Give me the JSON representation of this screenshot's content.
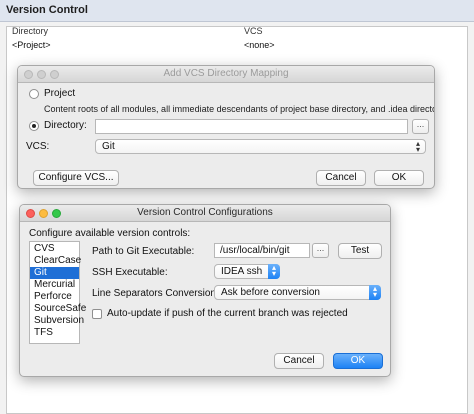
{
  "background": {
    "header_title": "Version Control",
    "columns": [
      "Directory",
      "VCS"
    ],
    "row": {
      "directory": "<Project>",
      "vcs": "<none>"
    }
  },
  "mapping_dialog": {
    "title": "Add VCS Directory Mapping",
    "project_label": "Project",
    "project_description": "Content roots of all modules, all immediate descendants of project base directory, and .idea directory contents",
    "directory_label": "Directory:",
    "directory_value": "",
    "browse_label": "...",
    "vcs_label": "VCS:",
    "vcs_value": "Git",
    "configure_label": "Configure VCS...",
    "cancel_label": "Cancel",
    "ok_label": "OK",
    "selected_option": "directory"
  },
  "config_dialog": {
    "title": "Version Control Configurations",
    "configure_label": "Configure available version controls:",
    "vcs_list": [
      {
        "name": "CVS"
      },
      {
        "name": "ClearCase"
      },
      {
        "name": "Git"
      },
      {
        "name": "Mercurial"
      },
      {
        "name": "Perforce"
      },
      {
        "name": "SourceSafe"
      },
      {
        "name": "Subversion"
      },
      {
        "name": "TFS"
      }
    ],
    "selected_vcs": "Git",
    "git_path_label": "Path to Git Executable:",
    "git_path_value": "/usr/local/bin/git",
    "browse_label": "...",
    "test_label": "Test",
    "ssh_label": "SSH Executable:",
    "ssh_value": "IDEA ssh",
    "line_sep_label": "Line Separators Conversion:",
    "line_sep_value": "Ask before conversion",
    "auto_update_label": "Auto-update if push of the current branch was rejected",
    "auto_update_checked": false,
    "cancel_label": "Cancel",
    "ok_label": "OK"
  },
  "colors": {
    "accent": "#1d82f5",
    "selection": "#1f6fd6"
  }
}
